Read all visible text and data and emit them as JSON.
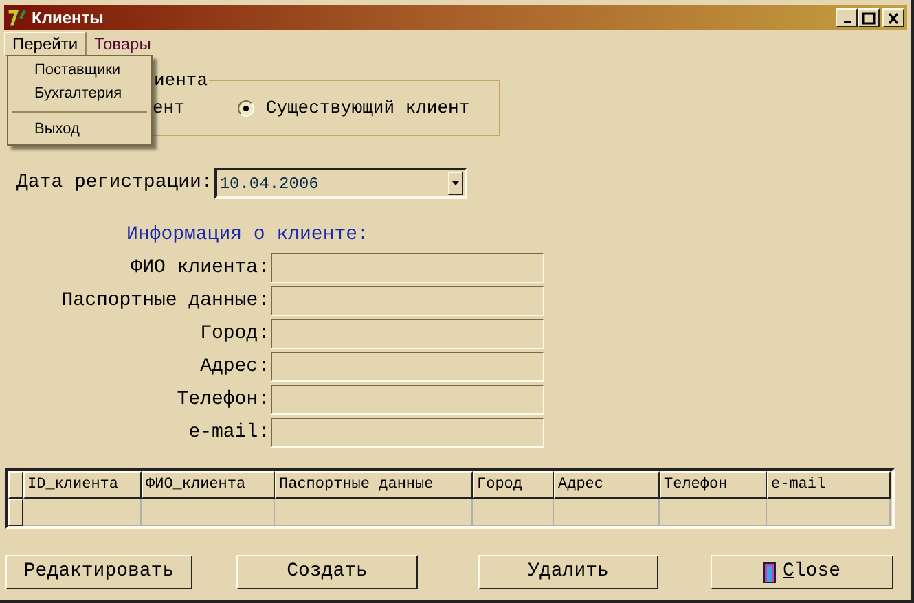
{
  "window": {
    "title": "Клиенты"
  },
  "menu_bar": [
    {
      "label": "Перейти",
      "selected": true
    },
    {
      "label": "Товары",
      "selected": false
    }
  ],
  "open_menu": {
    "items": [
      {
        "kind": "item",
        "label": "Поставщики"
      },
      {
        "kind": "item",
        "label": "Бухгалтерия"
      },
      {
        "kind": "separator"
      },
      {
        "kind": "item",
        "label": "Выход"
      }
    ]
  },
  "client_type_group": {
    "title": "иента",
    "options": [
      {
        "label": "ент",
        "selected": false
      },
      {
        "label": "Существующий клиент",
        "selected": true
      }
    ]
  },
  "registration_date": {
    "label": "Дата регистрации:",
    "value": "10.04.2006"
  },
  "client_info": {
    "heading": "Информация о клиенте:",
    "fields": [
      {
        "label": "ФИО клиента:"
      },
      {
        "label": "Паспортные данные:"
      },
      {
        "label": "Город:"
      },
      {
        "label": "Адрес:"
      },
      {
        "label": "Телефон:"
      },
      {
        "label": "e-mail:"
      }
    ]
  },
  "table": {
    "columns": [
      "ID_клиента",
      "ФИО_клиента",
      "Паспортные данные",
      "Город",
      "Адрес",
      "Телефон",
      "e-mail"
    ]
  },
  "buttons": [
    {
      "label": "Редактировать",
      "kind": "text"
    },
    {
      "label": "Создать",
      "kind": "text"
    },
    {
      "label": "Удалить",
      "kind": "text"
    },
    {
      "label": "Close",
      "kind": "close"
    }
  ]
}
